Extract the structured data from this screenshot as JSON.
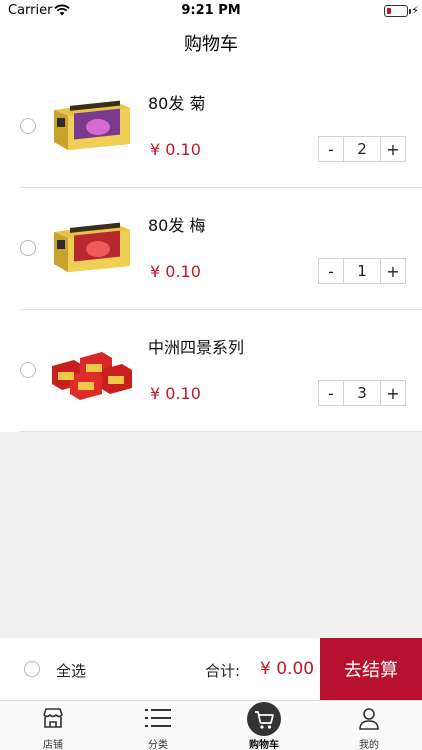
{
  "status_bar": {
    "carrier": "Carrier",
    "time": "9:21 PM",
    "icons": [
      "wifi-icon",
      "battery-icon",
      "charging-bolt-icon"
    ]
  },
  "nav": {
    "title": "购物车"
  },
  "cart": {
    "items": [
      {
        "name": "80发 菊",
        "price": "¥ 0.10",
        "quantity": "2",
        "minus": "-",
        "plus": "+"
      },
      {
        "name": "80发 梅",
        "price": "¥ 0.10",
        "quantity": "1",
        "minus": "-",
        "plus": "+"
      },
      {
        "name": "中洲四景系列",
        "price": "¥ 0.10",
        "quantity": "3",
        "minus": "-",
        "plus": "+"
      }
    ]
  },
  "checkout": {
    "select_all": "全选",
    "total_label": "合计:",
    "total_value": "¥ 0.00",
    "button": "去结算"
  },
  "tabs": [
    {
      "label": "店铺",
      "icon": "store-icon",
      "active": false
    },
    {
      "label": "分类",
      "icon": "list-icon",
      "active": false
    },
    {
      "label": "购物车",
      "icon": "cart-icon",
      "active": true
    },
    {
      "label": "我的",
      "icon": "user-icon",
      "active": false
    }
  ],
  "colors": {
    "accent": "#b8102f",
    "price": "#c4162d",
    "background_gray": "#f0f0f0"
  }
}
